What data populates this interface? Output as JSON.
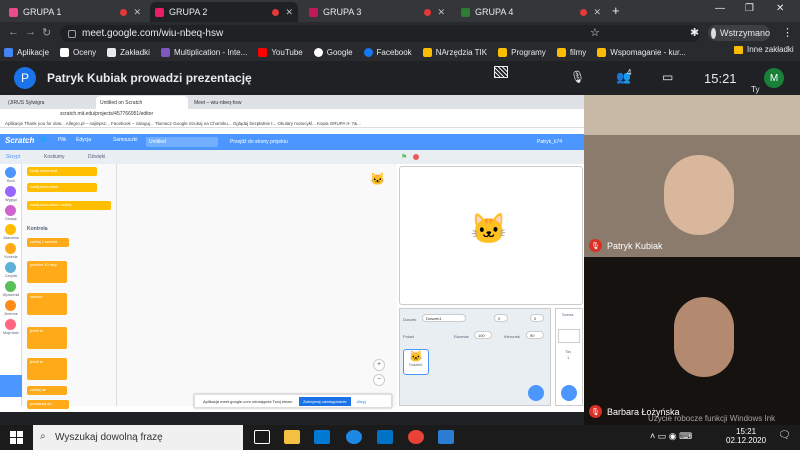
{
  "browser": {
    "tabs": [
      {
        "label": "GRUPA 1",
        "color": "#ea4c89"
      },
      {
        "label": "GRUPA 2",
        "color": "#e91e63"
      },
      {
        "label": "GRUPA 3",
        "color": "#c2185b"
      },
      {
        "label": "GRUPA 4",
        "color": "#2e7d32"
      }
    ],
    "url": "meet.google.com/wiu-nbeq-hsw",
    "profile_label": "Wstrzymano",
    "bookmarks": [
      "Aplikacje",
      "Oceny",
      "Zakładki",
      "Multiplication - Inte...",
      "YouTube",
      "Google",
      "Facebook",
      "NArzędzia TIK",
      "Programy",
      "filmy",
      "Wspomaganie - kur..."
    ],
    "bookmarks_other": "Inne zakładki"
  },
  "meet": {
    "presenter_initial": "P",
    "title": "Patryk Kubiak prowadzi prezentację",
    "participants_count": "4",
    "time": "15:21",
    "self_initial": "M",
    "self_label": "Ty",
    "participants": [
      {
        "name": "Patryk Kubiak"
      },
      {
        "name": "Barbara Łożyńska"
      }
    ],
    "accent": "#1a73e8"
  },
  "shared": {
    "tabs": [
      "(JIRUS Sylwigra",
      "Untitled on Scratch",
      "Meet – wiu-nbeq-hsw"
    ],
    "url": "scratch.mit.edu/projects/457766951/editor",
    "bookmarks": "Aplikacje   Thank you for dow...   Allegro.pl – najlepsz...   Facebook – zaloguj...   Tłumacz Google   Szukaj na Chomiku...   Oglądaj bezpłatnie t...   Okulary motocykl...   Kopia GRUPA II- 7&...",
    "menu": {
      "logo": "Scratch",
      "file": "Plik",
      "edit": "Edycja",
      "tutorials": "Samouczki",
      "project_name": "Untitled",
      "project_page": "Przejdź do strony projektu",
      "user": "Patryk_k74"
    },
    "subtabs": {
      "code": "Skrypt",
      "costumes": "Kostiumy",
      "sounds": "Dźwięki"
    },
    "categories": [
      {
        "label": "Ruch",
        "color": "#4c97ff"
      },
      {
        "label": "Wygląd",
        "color": "#9966ff"
      },
      {
        "label": "Dźwięk",
        "color": "#cf63cf"
      },
      {
        "label": "Zdarzenia",
        "color": "#ffbf00"
      },
      {
        "label": "Kontrola",
        "color": "#ffab19"
      },
      {
        "label": "Czujniki",
        "color": "#5cb1d6"
      },
      {
        "label": "Wyrażenia",
        "color": "#59c059"
      },
      {
        "label": "Zmienne",
        "color": "#ff8c1a"
      },
      {
        "label": "Moje bloki",
        "color": "#ff6680"
      }
    ],
    "palette_heading": "Kontrola",
    "blocks": [
      "czekaj 1 sekund",
      "powtórz 10 razy",
      "zawsze",
      "jeżeli to",
      "jeżeli to",
      "czekaj aż",
      "powtarzaj aż"
    ],
    "top_blocks": [
      "kiedy komunikat",
      "nadaj komunikat",
      "nadaj komunikat i czekaj"
    ],
    "sprite_pane": {
      "sprite_label": "Duszek",
      "sprite_name": "Duszek1",
      "x": "0",
      "y": "0",
      "show_label": "Pokaż",
      "size_label": "Rozmiar",
      "size": "100",
      "direction_label": "Kierunek",
      "direction": "90",
      "thumb_label": "Duszek1"
    },
    "scene_label": "Scena",
    "backdrops_label": "Tła",
    "backdrops_count": "1",
    "notice": {
      "text": "Aplikacja meet.google.com udostępnia Twój ekran.",
      "stop": "Zatrzymaj udostępnianie",
      "hide": "Ukryj"
    }
  },
  "taskbar": {
    "search_placeholder": "Wyszukaj dowolną frazę",
    "time": "15:21",
    "date": "02.12.2020",
    "watermark": "Użycie robocze funkcji Windows Ink"
  }
}
